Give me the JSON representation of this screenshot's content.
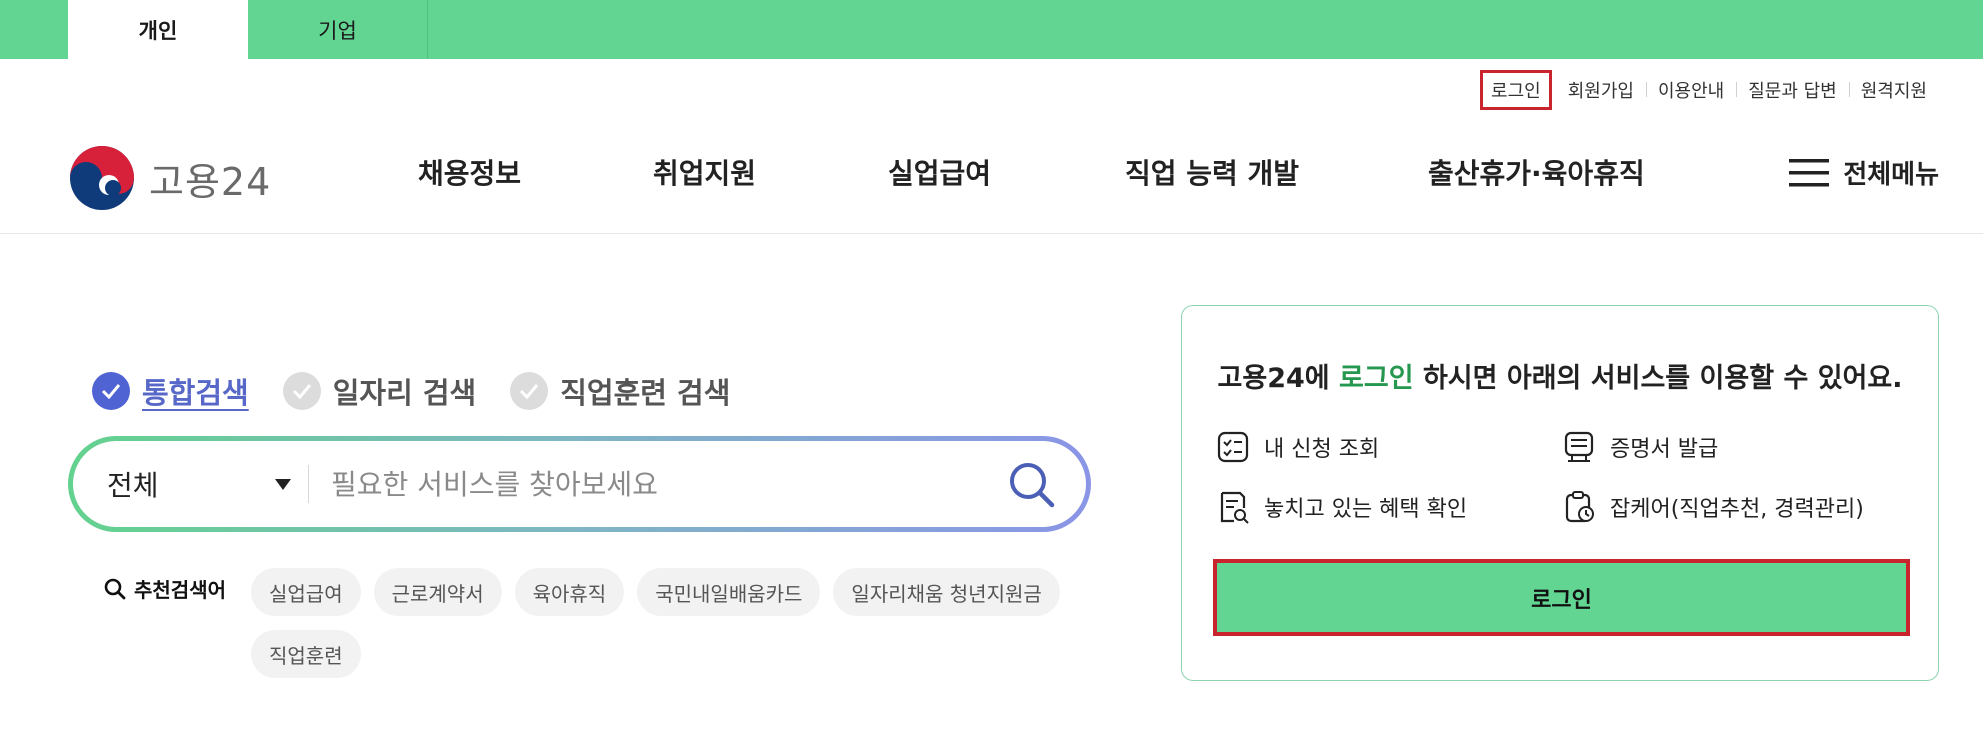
{
  "top_tabs": [
    {
      "label": "개인",
      "active": true
    },
    {
      "label": "기업",
      "active": false
    }
  ],
  "util_links": [
    "로그인",
    "회원가입",
    "이용안내",
    "질문과 답변",
    "원격지원"
  ],
  "logo": {
    "text": "고용24"
  },
  "gnb": [
    "채용정보",
    "취업지원",
    "실업급여",
    "직업 능력 개발",
    "출산휴가·육아휴직"
  ],
  "menu_all": {
    "label": "전체메뉴",
    "icon": "hamburger-icon"
  },
  "search": {
    "tabs": [
      {
        "label": "통합검색",
        "checked": true
      },
      {
        "label": "일자리 검색",
        "checked": false
      },
      {
        "label": "직업훈련 검색",
        "checked": false
      }
    ],
    "category": "전체",
    "placeholder": "필요한 서비스를 찾아보세요",
    "value": ""
  },
  "recommended": {
    "label": "추천검색어",
    "keywords": [
      "실업급여",
      "근로계약서",
      "육아휴직",
      "국민내일배움카드",
      "일자리채움 청년지원금",
      "직업훈련"
    ]
  },
  "login_card": {
    "title_pre": "고용24에 ",
    "title_hl": "로그인",
    "title_post": " 하시면 아래의 서비스를 이용할 수 있어요.",
    "services": [
      "내 신청 조회",
      "증명서 발급",
      "놓치고 있는 혜택 확인",
      "잡케어(직업추천, 경력관리)"
    ],
    "button": "로그인"
  },
  "colors": {
    "brand_green": "#62d592",
    "highlight_red": "#c8242e",
    "accent_blue": "#4f63d2",
    "title_green": "#25974f"
  }
}
